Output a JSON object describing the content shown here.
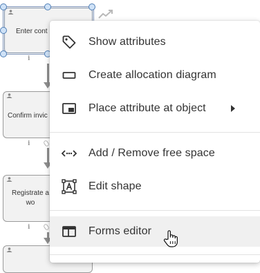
{
  "diagram": {
    "shapes": [
      {
        "label": "Enter cont",
        "selected": true
      },
      {
        "label": "Confirm invic"
      },
      {
        "label": "Registrate a\nwo"
      }
    ],
    "info_glyph": "i"
  },
  "context_menu": {
    "groups": [
      [
        {
          "label": "Show attributes",
          "icon": "tag-icon"
        },
        {
          "label": "Create allocation diagram",
          "icon": "rectangle-icon"
        },
        {
          "label": "Place attribute at object",
          "icon": "picture-in-picture-icon",
          "has_submenu": true
        }
      ],
      [
        {
          "label": "Add / Remove free space",
          "icon": "code-dots-icon"
        },
        {
          "label": "Edit shape",
          "icon": "text-frame-icon"
        }
      ],
      [
        {
          "label": "Forms editor",
          "icon": "form-window-icon",
          "hovered": true
        }
      ]
    ]
  },
  "colors": {
    "menu_text": "#333333",
    "hover_background": "#f0f0f0",
    "handle_fill": "#cfe2f7",
    "handle_stroke": "#4f7eb5"
  },
  "cursor": "hand-pointer-icon"
}
